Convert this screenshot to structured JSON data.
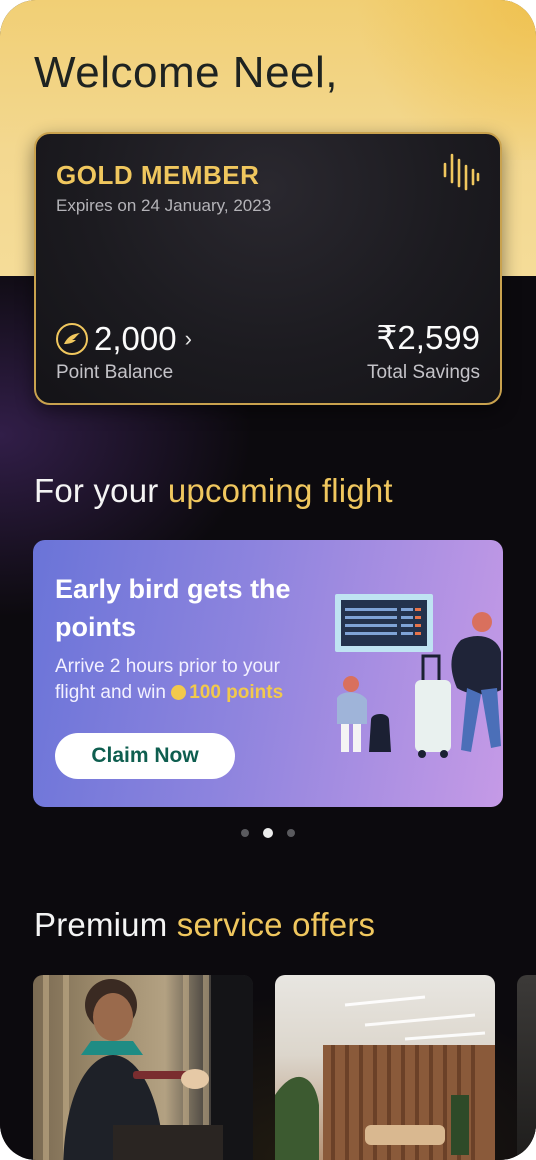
{
  "header": {
    "greeting": "Welcome Neel,"
  },
  "membership_card": {
    "tier": "GOLD MEMBER",
    "expiry": "Expires on 24 January, 2023",
    "points": "2,000",
    "points_label": "Point Balance",
    "savings": "₹2,599",
    "savings_label": "Total Savings"
  },
  "upcoming_section": {
    "title_plain": "For your ",
    "title_accent": "upcoming flight"
  },
  "promo_banner": {
    "title": "Early bird gets the points",
    "description_prefix": "Arrive 2 hours prior to your flight and win ",
    "points_text": "100 points",
    "cta_label": "Claim Now"
  },
  "carousel": {
    "total": 3,
    "active_index": 1
  },
  "premium_section": {
    "title_plain": "Premium ",
    "title_accent": "service offers"
  },
  "colors": {
    "gold": "#f0c75e",
    "cta_text": "#0e5e4f",
    "promo_start": "#6a74d8",
    "promo_end": "#c59ae6"
  },
  "icons": [
    "brand-logo-icon",
    "points-coin-icon",
    "chevron-right-icon"
  ]
}
